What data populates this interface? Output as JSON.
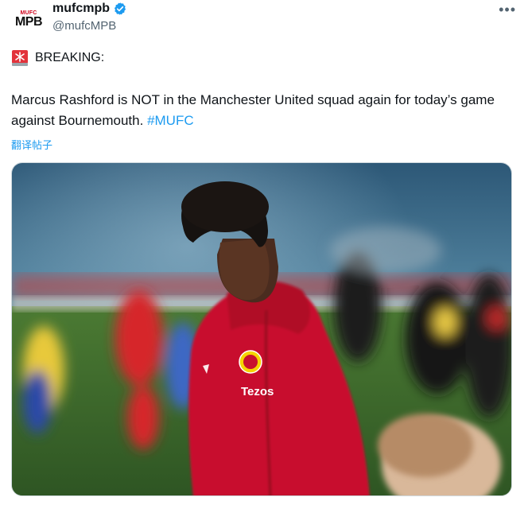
{
  "tweet": {
    "avatar": {
      "line1": "MUFC",
      "line2": "MPB"
    },
    "display_name": "mufcmpb",
    "handle": "@mufcMPB",
    "more_label": "•••",
    "breaking_label": "BREAKING:",
    "text_before_hashtag": "Marcus Rashford is NOT in the Manchester United squad again for today’s game against Bournemouth. ",
    "hashtag": "#MUFC",
    "translate_label": "翻译帖子",
    "media": {
      "shirt_text": "Tezos"
    }
  },
  "colors": {
    "verified": "#1d9bf0",
    "link": "#1d9bf0",
    "hoodie": "#c8102e",
    "pitch": "#3f6a2c"
  }
}
